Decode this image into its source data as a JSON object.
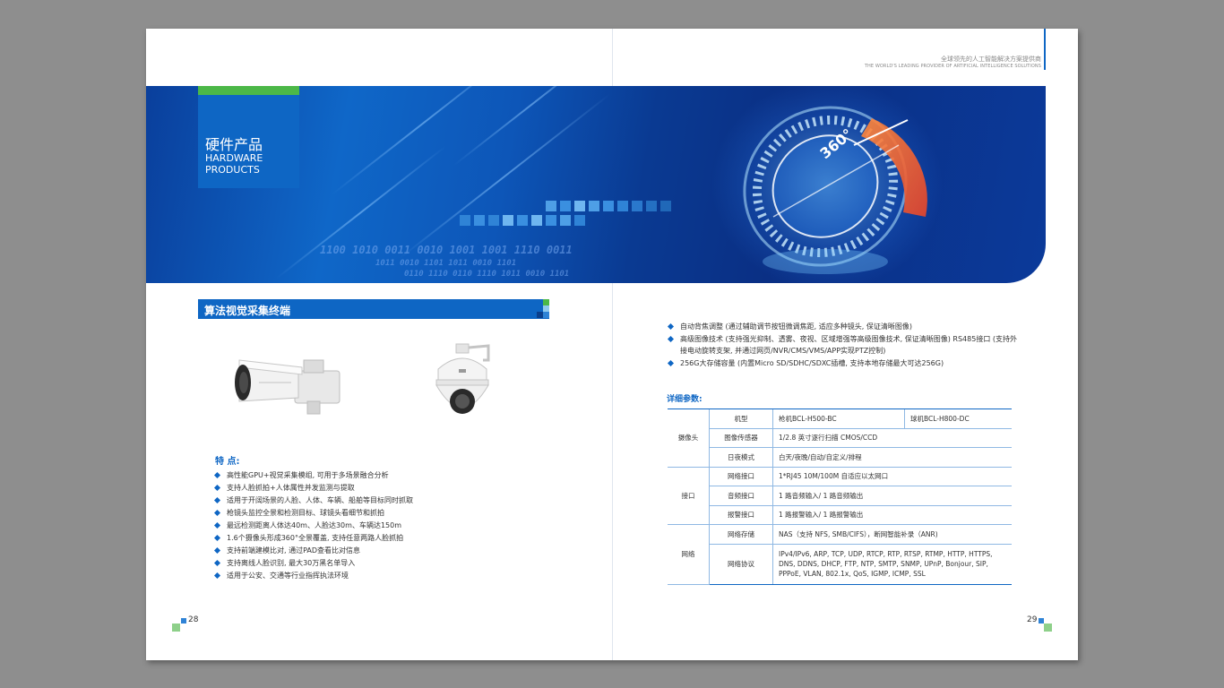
{
  "left_page": {
    "banner": {
      "title_zh": "硬件产品",
      "title_en_1": "HARDWARE",
      "title_en_2": "PRODUCTS",
      "binary_line_1": "1100 1010 0011 0010 1001 1001 1110 0011",
      "binary_line_2": "1011 0010 1101  1011 0010 1101",
      "binary_line_3": "0110 1110  0110 1110  1011 0010 1101"
    },
    "section_title": "算法视觉采集终端",
    "features_title": "特  点:",
    "features": [
      "高性能GPU+视觉采集模组, 可用于多场景融合分析",
      "支持人脸抓拍+人体属性并发监测与提取",
      "适用于开阔场景的人脸、人体、车辆、船舶等目标同时抓取",
      "枪镜头监控全景和检测目标、球镜头看细节和抓拍",
      "最远检测距离人体达40m、人脸达30m、车辆达150m",
      "1.6个摄像头形成360°全景覆盖, 支持任意两路人脸抓拍",
      "支持前端建模比对, 通过PAD查看比对信息",
      "支持离线人脸识别, 最大30万黑名单导入",
      "适用于公安、交通等行业指挥执法环境"
    ],
    "page_number": "28"
  },
  "right_page": {
    "header_zh": "全球领先的人工智能解决方案提供商",
    "header_en": "THE WORLD'S LEADING PROVIDER OF ARTIFICIAL INTELLIGENCE SOLUTIONS",
    "bullets": [
      "自动背焦调整 (通过辅助调节按钮微调焦距, 适应多种镜头, 保证清晰图像)",
      "高级图像技术 (支持强光抑制、透雾、夜视、区域增强等高级图像技术, 保证清晰图像) RS485接口 (支持外接电动旋转支架, 并通过网页/NVR/CMS/VMS/APP实现PTZ控制)",
      "256G大存储容量 (内置Micro SD/SDHC/SDXC插槽, 支持本地存储最大可达256G)"
    ],
    "params_title": "详细参数:",
    "table": {
      "groups": [
        "摄像头",
        "接口",
        "网络"
      ],
      "rows": [
        {
          "label": "机型",
          "value": "枪机BCL-H500-BC",
          "value2": "球机BCL-H800-DC"
        },
        {
          "label": "图像传感器",
          "value": "1/2.8 英寸逐行扫描 CMOS/CCD"
        },
        {
          "label": "日夜模式",
          "value": "白天/夜晚/自动/自定义/排程"
        },
        {
          "label": "网络接口",
          "value": "1*RJ45 10M/100M 自适应以太网口"
        },
        {
          "label": "音频接口",
          "value": "1 路音频输入/ 1 路音频输出"
        },
        {
          "label": "报警接口",
          "value": "1 路报警输入/ 1 路报警输出"
        },
        {
          "label": "网络存储",
          "value": "NAS（支持 NFS, SMB/CIFS），断网智能补录（ANR)"
        },
        {
          "label": "网络协议",
          "value": "IPv4/IPv6, ARP, TCP, UDP, RTCP, RTP, RTSP, RTMP, HTTP, HTTPS, DNS, DDNS, DHCP, FTP, NTP, SMTP, SNMP, UPnP, Bonjour, SIP, PPPoE, VLAN, 802.1x, QoS, IGMP, ICMP, SSL"
        }
      ]
    },
    "page_number": "29"
  },
  "colors": {
    "brand_blue": "#0e66c4",
    "accent_green": "#4cb848",
    "banner_dark": "#0a2f84",
    "background": "#8e8e8e"
  },
  "images": {
    "bullet_camera": "bullet-camera-image",
    "dome_camera": "ptz-dome-camera-image",
    "banner_art": "360-lens-tech-illustration"
  }
}
